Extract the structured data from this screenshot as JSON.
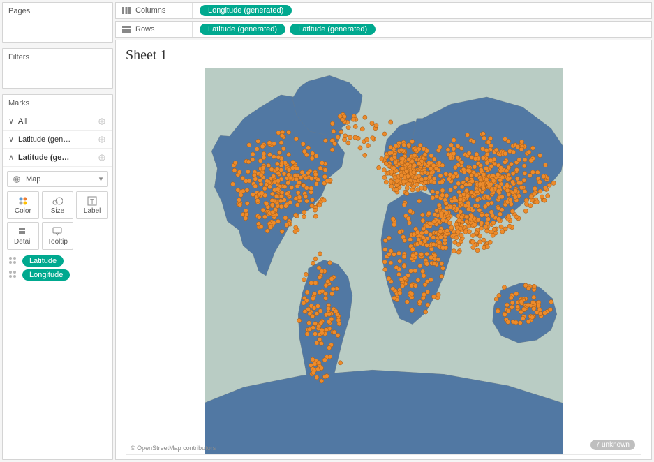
{
  "pages": {
    "title": "Pages"
  },
  "filters": {
    "title": "Filters"
  },
  "marks": {
    "title": "Marks",
    "rows": [
      {
        "label": "All",
        "chev": "∨",
        "active": false
      },
      {
        "label": "Latitude (gen…",
        "chev": "∨",
        "active": false
      },
      {
        "label": "Latitude (ge…",
        "chev": "∧",
        "active": true
      }
    ],
    "mark_type": "Map",
    "shelves": {
      "color": "Color",
      "size": "Size",
      "label": "Label",
      "detail": "Detail",
      "tooltip": "Tooltip"
    },
    "pills": [
      {
        "label": "Latitude"
      },
      {
        "label": "Longitude"
      }
    ]
  },
  "columns": {
    "label": "Columns",
    "pills": [
      "Longitude (generated)"
    ]
  },
  "rows": {
    "label": "Rows",
    "pills": [
      "Latitude (generated)",
      "Latitude (generated)"
    ]
  },
  "viz": {
    "title": "Sheet 1",
    "attribution": "© OpenStreetMap contributors",
    "unknown_badge": "7 unknown"
  },
  "colors": {
    "pill": "#00a98f",
    "ocean": "#b9ccc4",
    "land": "#5178a3",
    "dot": "#ed8b2b",
    "dot_stroke": "#a55c17"
  }
}
